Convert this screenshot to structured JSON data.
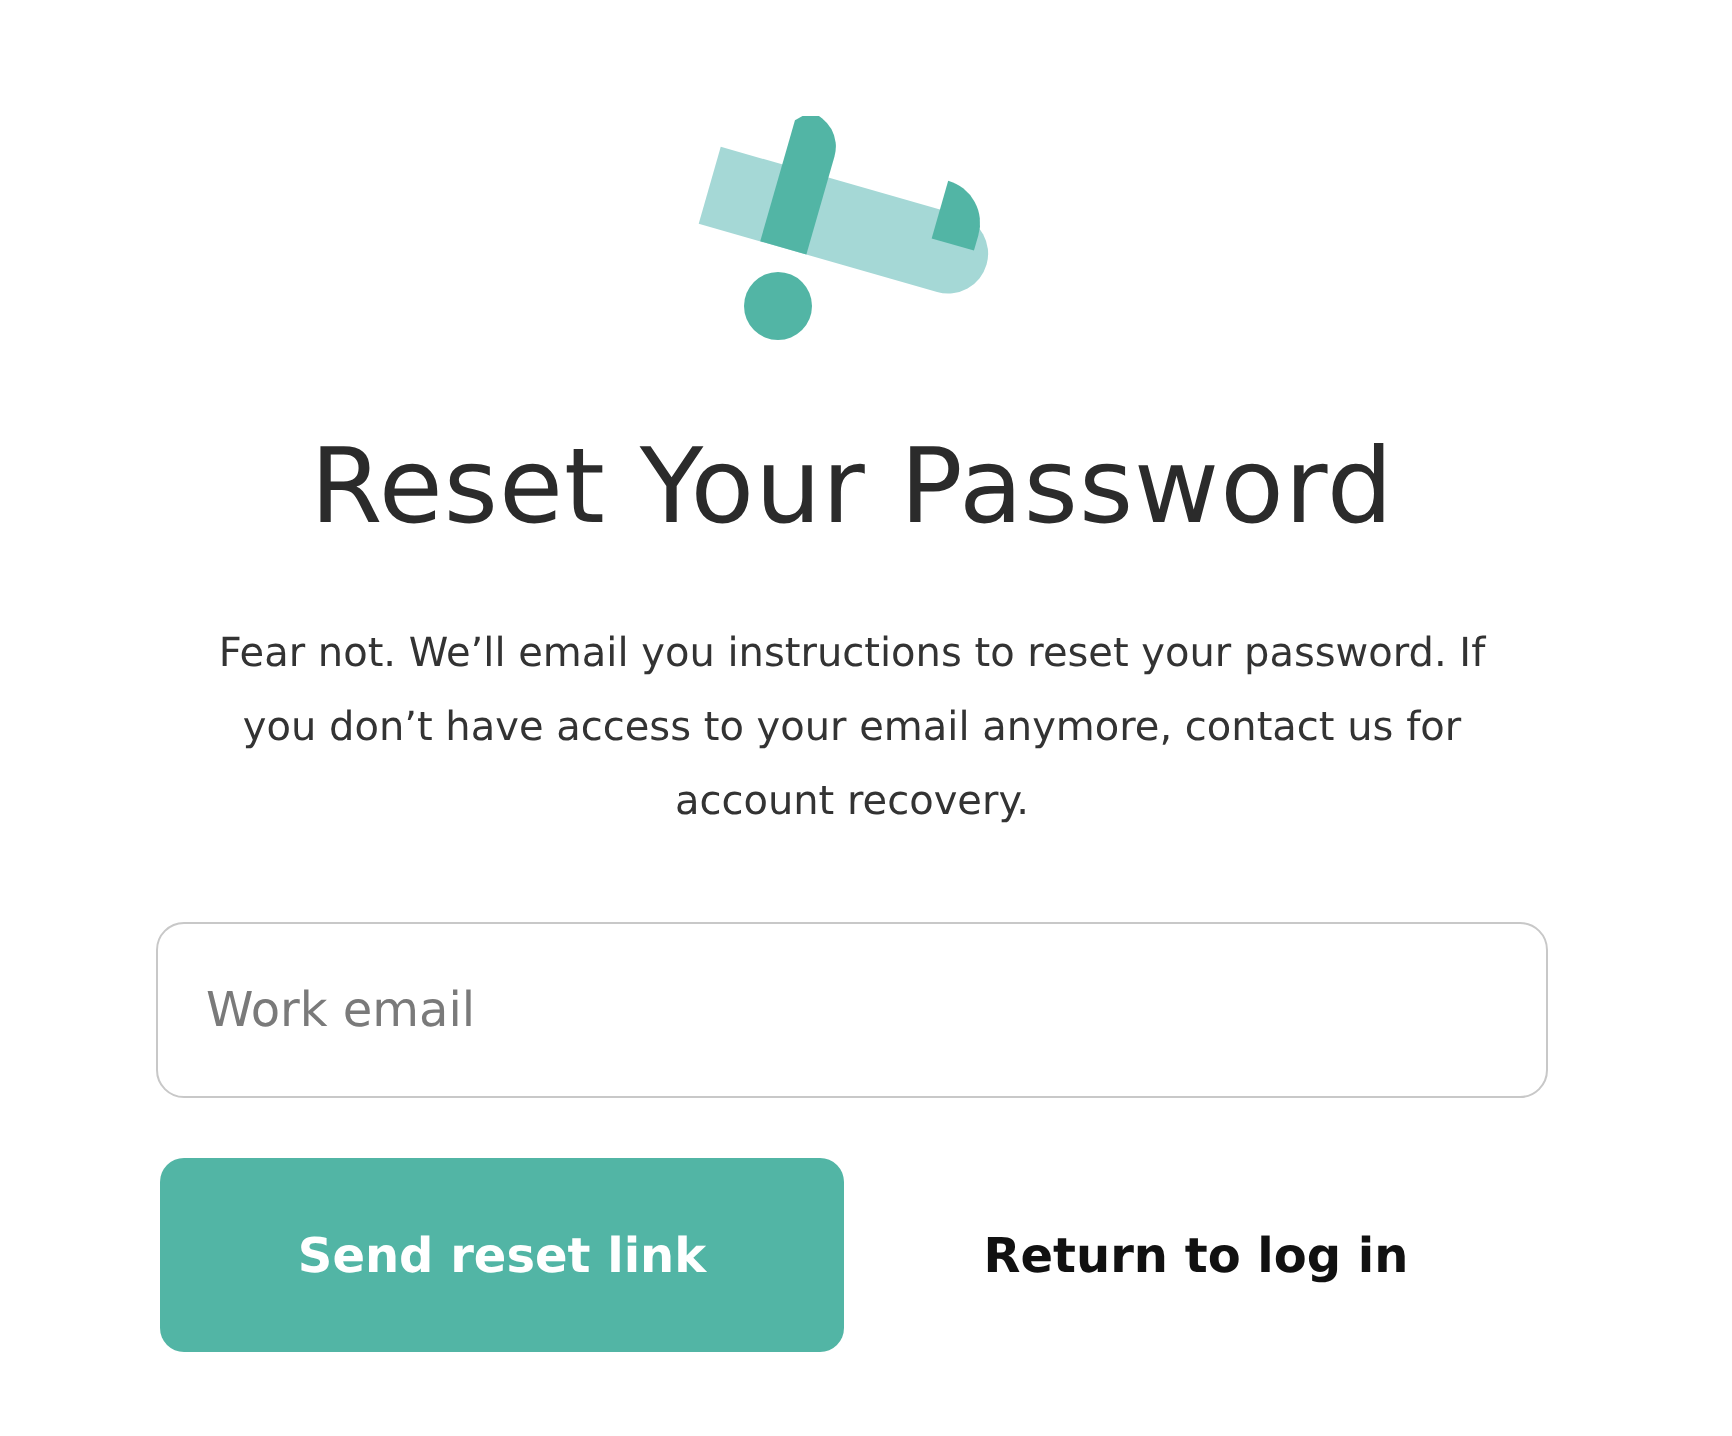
{
  "heading": "Reset Your Password",
  "description": "Fear not. We’ll email you instructions to reset your password. If you don’t have access to your email anymore, contact us for account recovery.",
  "email_field": {
    "placeholder": "Work email"
  },
  "submit_button": {
    "label": "Send reset link"
  },
  "return_link": {
    "label": "Return to log in"
  }
}
